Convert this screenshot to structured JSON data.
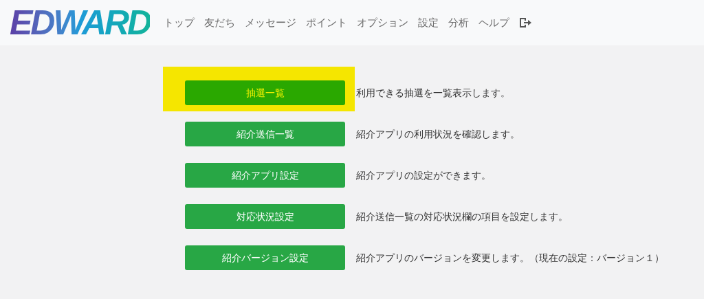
{
  "header": {
    "logo": "EDWARD",
    "nav": [
      {
        "label": "トップ"
      },
      {
        "label": "友だち"
      },
      {
        "label": "メッセージ"
      },
      {
        "label": "ポイント"
      },
      {
        "label": "オプション"
      },
      {
        "label": "設定"
      },
      {
        "label": "分析"
      },
      {
        "label": "ヘルプ"
      }
    ]
  },
  "menu": [
    {
      "button": "抽選一覧",
      "description": "利用できる抽選を一覧表示します。",
      "highlighted": true
    },
    {
      "button": "紹介送信一覧",
      "description": "紹介アプリの利用状況を確認します。",
      "highlighted": false
    },
    {
      "button": "紹介アプリ設定",
      "description": "紹介アプリの設定ができます。",
      "highlighted": false
    },
    {
      "button": "対応状況設定",
      "description": "紹介送信一覧の対応状況欄の項目を設定します。",
      "highlighted": false
    },
    {
      "button": "紹介バージョン設定",
      "description": "紹介アプリのバージョンを変更します。（現在の設定：バージョン１）",
      "highlighted": false
    }
  ]
}
